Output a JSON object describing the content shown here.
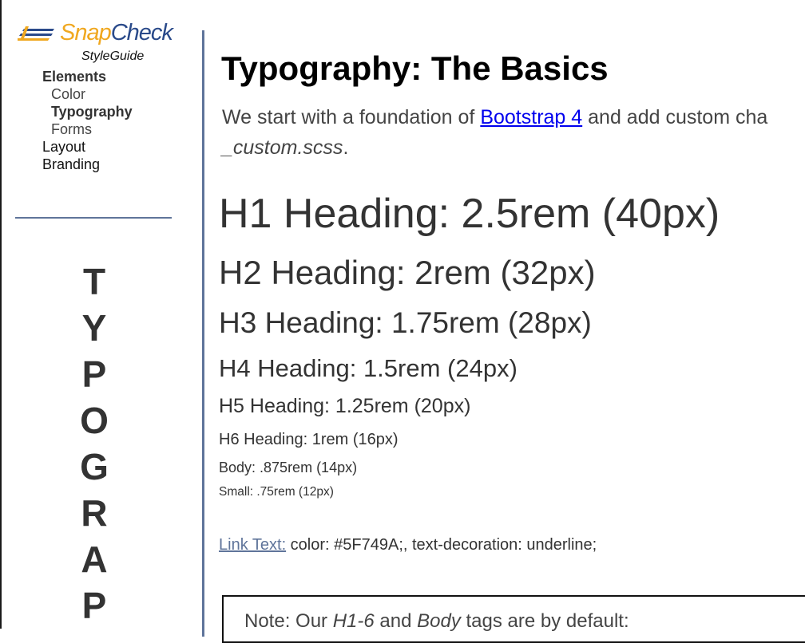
{
  "sidebar": {
    "logo": {
      "snap": "Snap",
      "check": "Check",
      "icon": "lines-logo-icon",
      "colors": {
        "snap": "#F0A820",
        "check": "#2A4A8A"
      }
    },
    "subtitle": "StyleGuide",
    "nav": [
      {
        "label": "Elements",
        "level": 0,
        "bold": true
      },
      {
        "label": "Color",
        "level": 1,
        "bold": false
      },
      {
        "label": "Typography",
        "level": 1,
        "bold": true,
        "active": true
      },
      {
        "label": "Forms",
        "level": 1,
        "bold": false
      },
      {
        "label": "Layout",
        "level": 0,
        "bold": false
      },
      {
        "label": "Branding",
        "level": 0,
        "bold": false
      }
    ],
    "vertical_letters": [
      "T",
      "Y",
      "P",
      "O",
      "G",
      "R",
      "A",
      "P"
    ]
  },
  "main": {
    "title": "Typography: The Basics",
    "intro": {
      "before": "We start with a foundation of ",
      "link": "Bootstrap 4",
      "after": " and add custom cha",
      "file": "_custom.scss",
      "end": "."
    },
    "samples": {
      "h1": "H1 Heading: 2.5rem (40px)",
      "h2": "H2 Heading: 2rem (32px)",
      "h3": "H3 Heading: 1.75rem (28px)",
      "h4": "H4 Heading: 1.5rem (24px)",
      "h5": "H5 Heading: 1.25rem (20px)",
      "h6": "H6 Heading: 1rem (16px)",
      "body": "Body: .875rem (14px)",
      "small": "Small: .75rem (12px)"
    },
    "link_example": {
      "label": "Link Text:",
      "description": " color: #5F749A;, text-decoration: underline;"
    },
    "note": {
      "prefix": "Note: Our ",
      "em1": "H1-6",
      "mid": " and ",
      "em2": "Body",
      "suffix": " tags are by default:"
    }
  },
  "colors": {
    "accent": "#5F749A",
    "link": "#0000EE"
  }
}
